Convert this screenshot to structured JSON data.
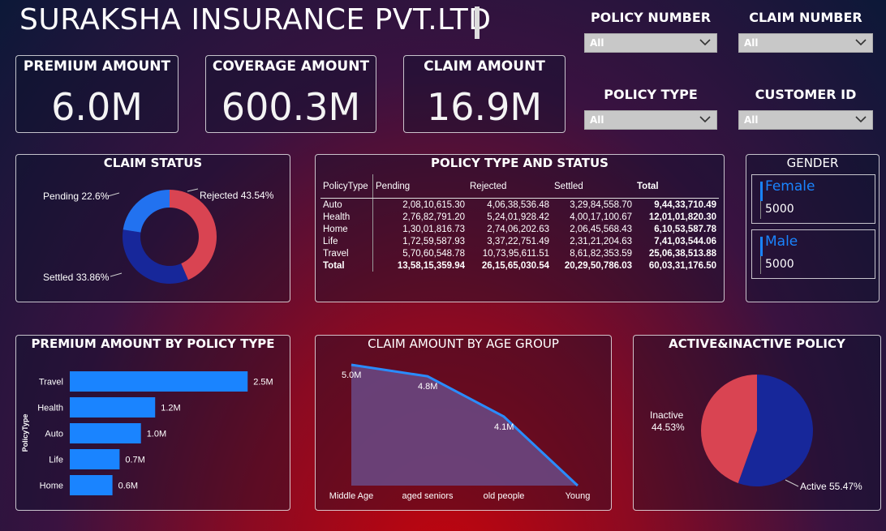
{
  "header": {
    "title": "SURAKSHA INSURANCE PVT.LTD"
  },
  "kpis": [
    {
      "label": "PREMIUM AMOUNT",
      "value": "6.0M"
    },
    {
      "label": "COVERAGE AMOUNT",
      "value": "600.3M"
    },
    {
      "label": "CLAIM AMOUNT",
      "value": "16.9M"
    }
  ],
  "slicers": [
    {
      "label": "POLICY NUMBER",
      "value": "All"
    },
    {
      "label": "CLAIM NUMBER",
      "value": "All"
    },
    {
      "label": "POLICY TYPE",
      "value": "All"
    },
    {
      "label": "CUSTOMER ID",
      "value": "All"
    }
  ],
  "claim_status": {
    "title": "CLAIM STATUS",
    "labels": [
      "Rejected 43.54%",
      "Settled 33.86%",
      "Pending 22.6%"
    ]
  },
  "policy_table": {
    "title": "POLICY TYPE AND STATUS",
    "headers": [
      "PolicyType",
      "Pending",
      "Rejected",
      "Settled",
      "Total"
    ],
    "rows": [
      [
        "Auto",
        "2,08,10,615.30",
        "4,06,38,536.48",
        "3,29,84,558.70",
        "9,44,33,710.49"
      ],
      [
        "Health",
        "2,76,82,791.20",
        "5,24,01,928.42",
        "4,00,17,100.67",
        "12,01,01,820.30"
      ],
      [
        "Home",
        "1,30,01,816.73",
        "2,74,06,202.63",
        "2,06,45,568.43",
        "6,10,53,587.78"
      ],
      [
        "Life",
        "1,72,59,587.93",
        "3,37,22,751.49",
        "2,31,21,204.63",
        "7,41,03,544.06"
      ],
      [
        "Travel",
        "5,70,60,548.78",
        "10,73,95,611.51",
        "8,61,82,353.59",
        "25,06,38,513.88"
      ]
    ],
    "total": [
      "Total",
      "13,58,15,359.94",
      "26,15,65,030.54",
      "20,29,50,786.03",
      "60,03,31,176.50"
    ]
  },
  "gender": {
    "title": "GENDER",
    "items": [
      {
        "name": "Female",
        "count": "5000"
      },
      {
        "name": "Male",
        "count": "5000"
      }
    ]
  },
  "colors": {
    "accent": "#1a84ff",
    "bar": "#1a84ff",
    "navy": "#17279a",
    "red": "#d94452",
    "blue": "#2272f0"
  },
  "chart_data": [
    {
      "type": "pie",
      "variant": "donut",
      "title": "CLAIM STATUS",
      "categories": [
        "Rejected",
        "Settled",
        "Pending"
      ],
      "values": [
        43.54,
        33.86,
        22.6
      ],
      "colors": [
        "#d94452",
        "#17279a",
        "#2272f0"
      ]
    },
    {
      "type": "bar",
      "orientation": "horizontal",
      "title": "PREMIUM AMOUNT BY POLICY TYPE",
      "ylabel": "PolicyType",
      "categories": [
        "Travel",
        "Health",
        "Auto",
        "Life",
        "Home"
      ],
      "values": [
        2.5,
        1.2,
        1.0,
        0.7,
        0.6
      ],
      "value_labels": [
        "2.5M",
        "1.2M",
        "1.0M",
        "0.7M",
        "0.6M"
      ],
      "unit": "M",
      "xlim": [
        0,
        2.6
      ]
    },
    {
      "type": "area",
      "title": "CLAIM AMOUNT BY AGE GROUP",
      "categories": [
        "Middle Age",
        "aged seniors",
        "old people",
        "Young"
      ],
      "values": [
        5.0,
        4.8,
        4.1,
        2.9
      ],
      "value_labels": [
        "5.0M",
        "4.8M",
        "4.1M",
        ""
      ],
      "unit": "M",
      "ylim": [
        2.9,
        5.0
      ]
    },
    {
      "type": "pie",
      "title": "ACTIVE&INACTIVE POLICY",
      "categories": [
        "Active",
        "Inactive"
      ],
      "values": [
        55.47,
        44.53
      ],
      "labels": [
        "Active 55.47%",
        "Inactive",
        "44.53%"
      ],
      "colors": [
        "#17279a",
        "#d94452"
      ]
    }
  ]
}
